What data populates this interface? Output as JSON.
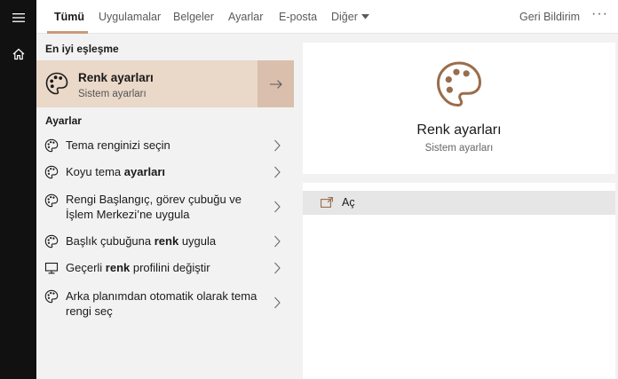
{
  "window": {
    "rail": {
      "menu_icon": "hamburger-icon",
      "home_icon": "home-icon"
    },
    "tabs": [
      {
        "label": "Tümü",
        "active": true
      },
      {
        "label": "Uygulamalar",
        "active": false
      },
      {
        "label": "Belgeler",
        "active": false
      },
      {
        "label": "Ayarlar",
        "active": false
      },
      {
        "label": "E-posta",
        "active": false
      },
      {
        "label": "Diğer",
        "active": false
      }
    ],
    "feedback_label": "Geri Bildirim",
    "more_label": "···",
    "accent_color": "#c79a7b"
  },
  "results": {
    "best_match_header": "En iyi eşleşme",
    "best_match": {
      "title": "Renk ayarları",
      "subtitle": "Sistem ayarları",
      "icon": "palette-icon",
      "highlight_color": "#ead8c8"
    },
    "settings_header": "Ayarlar",
    "settings_items": [
      {
        "text_before": "Tema renginizi seçin",
        "text_bold": "",
        "text_after": "",
        "icon": "palette-icon"
      },
      {
        "text_before": "Koyu tema ",
        "text_bold": "ayarları",
        "text_after": "",
        "icon": "palette-icon"
      },
      {
        "text_before": "Rengi Başlangıç, görev çubuğu ve İşlem Merkezi’ne uygula",
        "text_bold": "",
        "text_after": "",
        "icon": "palette-icon"
      },
      {
        "text_before": "Başlık çubuğuna ",
        "text_bold": "renk",
        "text_after": " uygula",
        "icon": "palette-icon"
      },
      {
        "text_before": "Geçerli ",
        "text_bold": "renk",
        "text_after": " profilini değiştir",
        "icon": "monitor-icon"
      },
      {
        "text_before": "Arka planımdan otomatik olarak tema rengi seç",
        "text_bold": "",
        "text_after": "",
        "icon": "palette-icon"
      }
    ]
  },
  "preview": {
    "title": "Renk ayarları",
    "subtitle": "Sistem ayarları",
    "icon": "palette-icon",
    "actions": [
      {
        "label": "Aç",
        "icon": "open-icon"
      }
    ]
  }
}
